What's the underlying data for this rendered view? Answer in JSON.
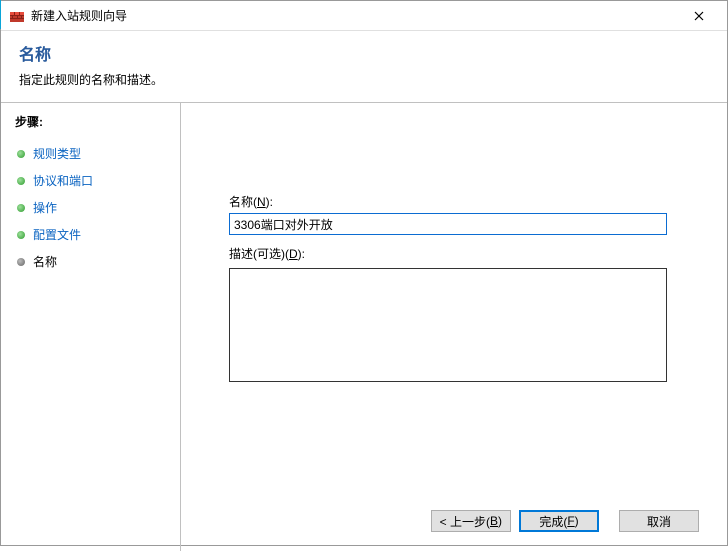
{
  "window": {
    "title": "新建入站规则向导",
    "close_label": "×"
  },
  "header": {
    "title": "名称",
    "subtitle": "指定此规则的名称和描述。"
  },
  "sidebar": {
    "steps_label": "步骤:",
    "items": [
      {
        "label": "规则类型",
        "state": "done"
      },
      {
        "label": "协议和端口",
        "state": "done"
      },
      {
        "label": "操作",
        "state": "done"
      },
      {
        "label": "配置文件",
        "state": "done"
      },
      {
        "label": "名称",
        "state": "current"
      }
    ]
  },
  "form": {
    "name_label_prefix": "名称(",
    "name_label_hotkey": "N",
    "name_label_suffix": "):",
    "name_value": "3306端口对外开放",
    "desc_label_prefix": "描述(可选)(",
    "desc_label_hotkey": "D",
    "desc_label_suffix": "):",
    "desc_value": ""
  },
  "footer": {
    "back_prefix": "< 上一步(",
    "back_hotkey": "B",
    "back_suffix": ")",
    "finish_prefix": "完成(",
    "finish_hotkey": "F",
    "finish_suffix": ")",
    "cancel": "取消"
  }
}
